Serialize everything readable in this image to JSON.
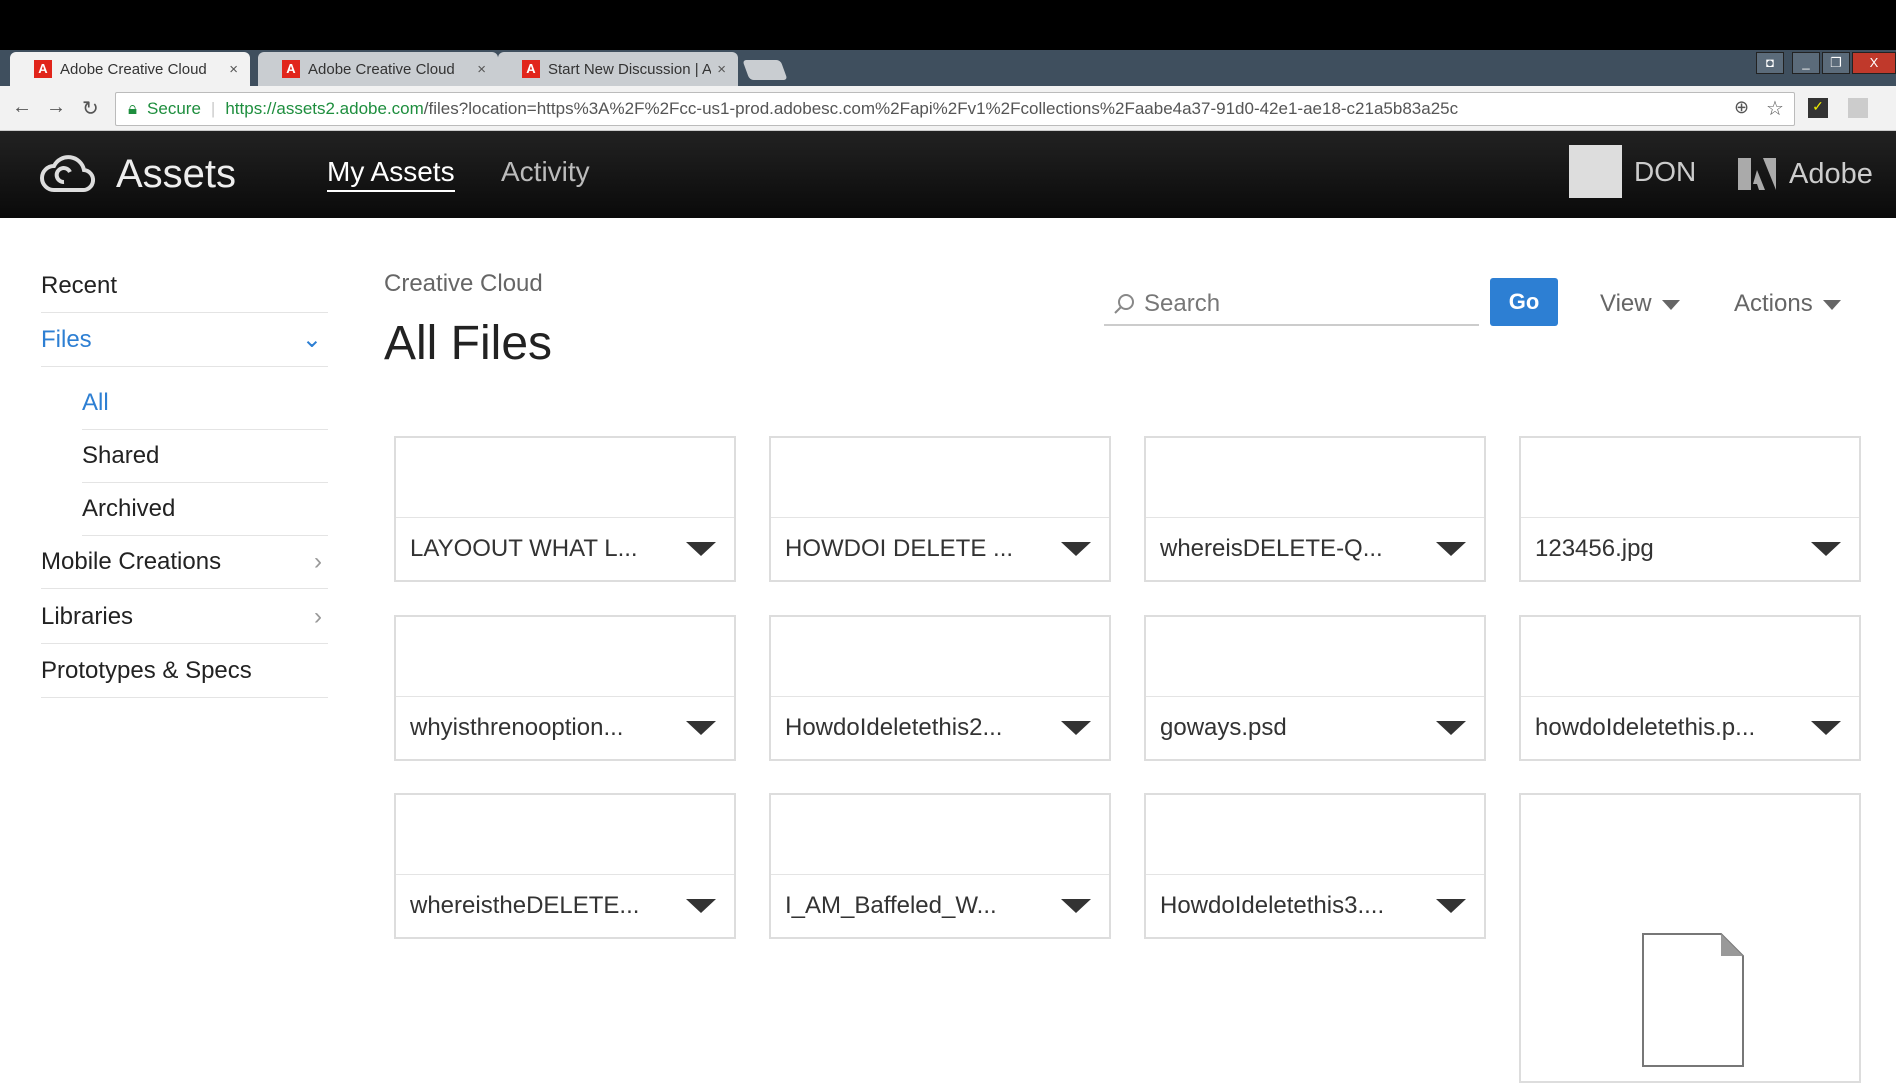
{
  "browser": {
    "tabs": [
      {
        "title": "Adobe Creative Cloud",
        "active": true
      },
      {
        "title": "Adobe Creative Cloud",
        "active": false
      },
      {
        "title": "Start New Discussion | Ac",
        "active": false
      }
    ],
    "secure_label": "Secure",
    "url_host": "https://assets2.adobe.com",
    "url_rest": "/files?location=https%3A%2F%2Fcc-us1-prod.adobesc.com%2Fapi%2Fv1%2Fcollections%2Faabe4a37-91d0-42e1-ae18-c21a5b83a25c"
  },
  "header": {
    "app_title": "Assets",
    "nav": [
      "My Assets",
      "Activity"
    ],
    "user": "DON",
    "brand": "Adobe"
  },
  "sidebar": {
    "items": [
      {
        "label": "Recent"
      },
      {
        "label": "Files",
        "expanded": true
      },
      {
        "label": "All",
        "selected": true
      },
      {
        "label": "Shared"
      },
      {
        "label": "Archived"
      },
      {
        "label": "Mobile Creations"
      },
      {
        "label": "Libraries"
      },
      {
        "label": "Prototypes & Specs"
      }
    ]
  },
  "main": {
    "breadcrumb": "Creative Cloud",
    "title": "All Files",
    "search_placeholder": "Search",
    "go_label": "Go",
    "view_label": "View",
    "actions_label": "Actions",
    "files": [
      "LAYOOUT WHAT L...",
      "HOWDOI DELETE ...",
      "whereisDELETE-Q...",
      "123456.jpg",
      "whyisthrenooption...",
      "HowdoIdeletethis2...",
      "goways.psd",
      "howdoIdeletethis.p...",
      "whereistheDELETE...",
      "I_AM_Baffeled_W...",
      "HowdoIdeletethis3...."
    ]
  },
  "colors": {
    "accent": "#2d7fd3",
    "header_bg": "#111111"
  }
}
